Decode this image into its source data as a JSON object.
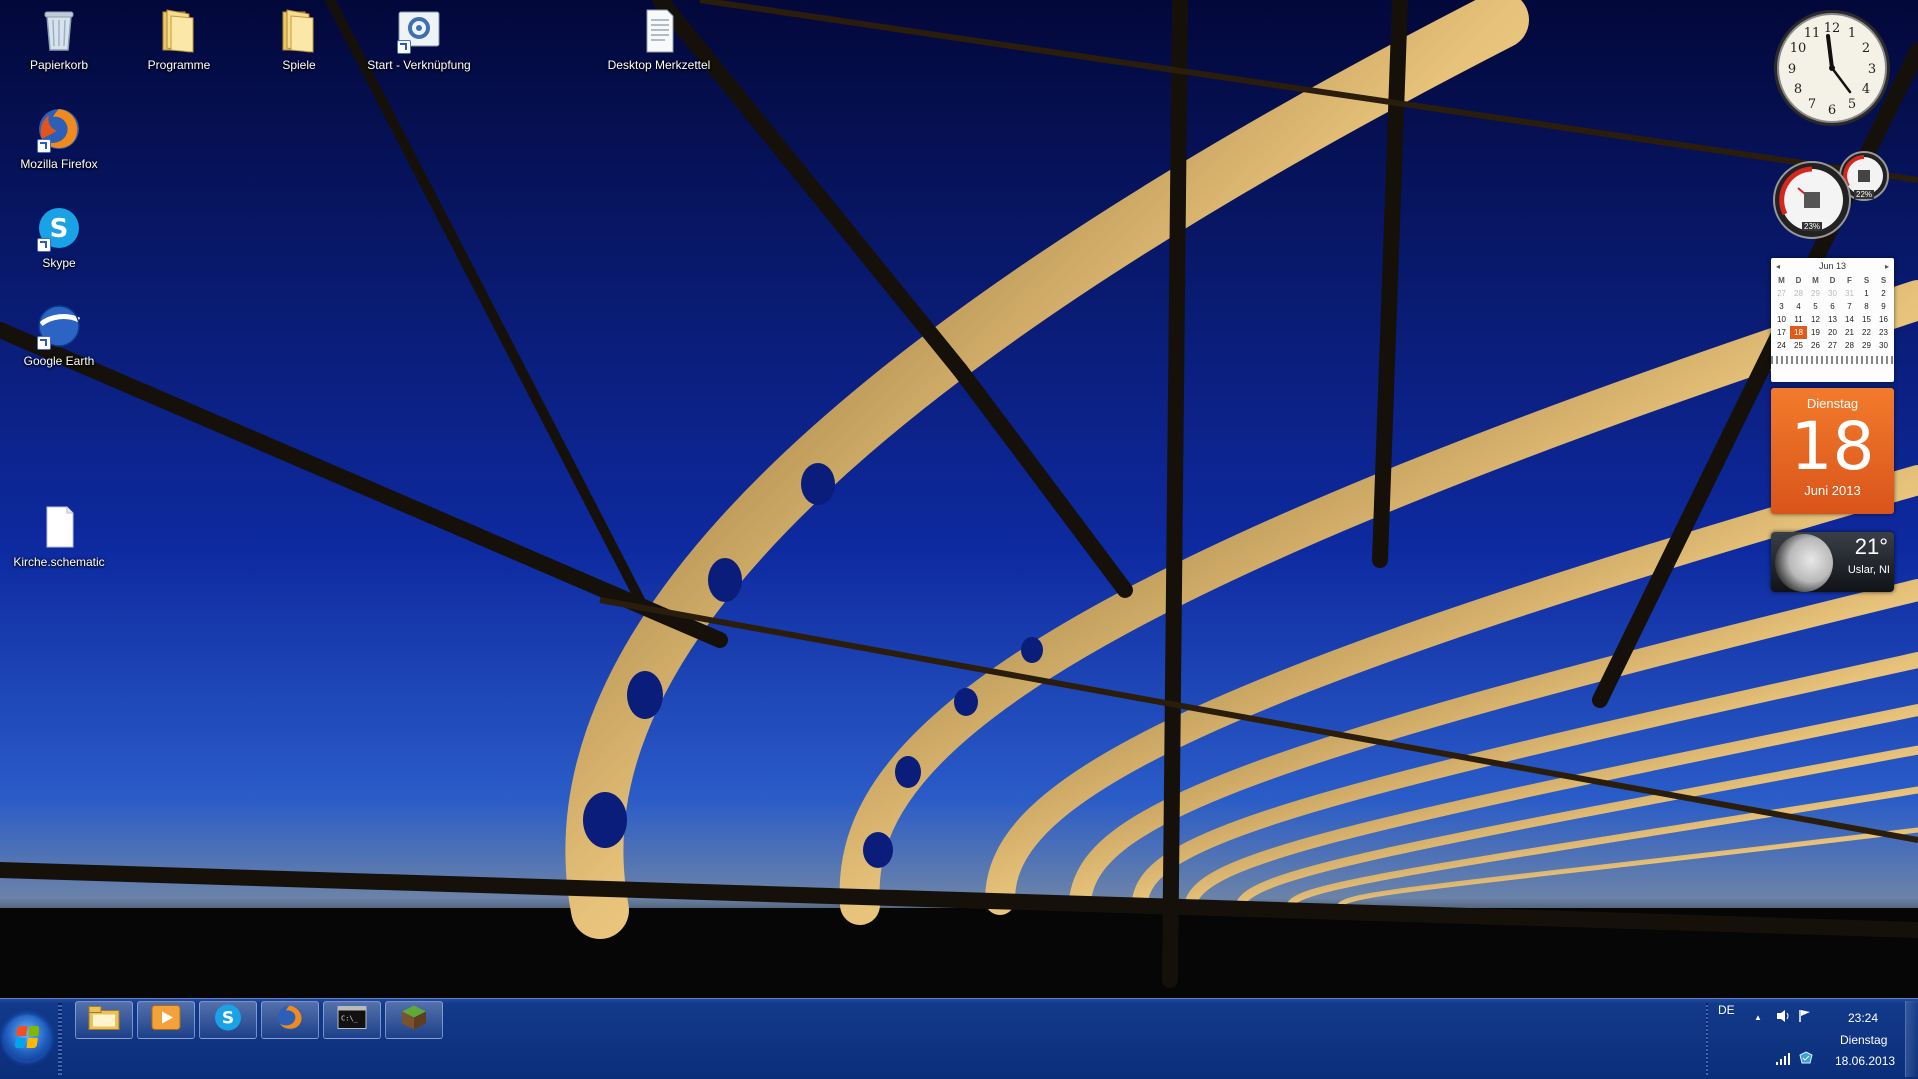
{
  "desktop": {
    "icons": [
      {
        "label": "Papierkorb",
        "icon": "recycle-bin-icon"
      },
      {
        "label": "Programme",
        "icon": "folder-icon"
      },
      {
        "label": "Spiele",
        "icon": "folder-icon"
      },
      {
        "label": "Start - Verknüpfung",
        "icon": "shortcut-settings-icon"
      },
      {
        "label": "Desktop Merkzettel",
        "icon": "text-document-icon"
      },
      {
        "label": "Mozilla Firefox",
        "icon": "firefox-icon"
      },
      {
        "label": "Skype",
        "icon": "skype-icon"
      },
      {
        "label": "Google Earth",
        "icon": "google-earth-icon"
      },
      {
        "label": "Kirche.schematic",
        "icon": "blank-file-icon"
      }
    ]
  },
  "gadgets": {
    "clock": {
      "numerals": [
        "12",
        "1",
        "2",
        "3",
        "4",
        "5",
        "6",
        "7",
        "8",
        "9",
        "10",
        "11"
      ]
    },
    "cpu_meter": {
      "cpu_percent": "23%",
      "ram_percent": "22%"
    },
    "calendar": {
      "month_title": "Jun 13",
      "prev": "◂",
      "next": "▸",
      "weekdays": [
        "M",
        "D",
        "M",
        "D",
        "F",
        "S",
        "S"
      ],
      "weeks": [
        [
          "27",
          "28",
          "29",
          "30",
          "31",
          "1",
          "2"
        ],
        [
          "3",
          "4",
          "5",
          "6",
          "7",
          "8",
          "9"
        ],
        [
          "10",
          "11",
          "12",
          "13",
          "14",
          "15",
          "16"
        ],
        [
          "17",
          "18",
          "19",
          "20",
          "21",
          "22",
          "23"
        ],
        [
          "24",
          "25",
          "26",
          "27",
          "28",
          "29",
          "30"
        ]
      ],
      "today": "18",
      "weekday_name": "Dienstag",
      "month_year": "Juni 2013"
    },
    "weather": {
      "temperature": "21°",
      "location": "Uslar, NI"
    }
  },
  "taskbar": {
    "buttons": [
      {
        "name": "explorer",
        "icon": "folder-explorer-icon"
      },
      {
        "name": "media-player",
        "icon": "media-player-icon"
      },
      {
        "name": "skype",
        "icon": "skype-icon"
      },
      {
        "name": "firefox",
        "icon": "firefox-icon"
      },
      {
        "name": "cmd",
        "icon": "command-prompt-icon"
      },
      {
        "name": "minecraft",
        "icon": "minecraft-icon"
      }
    ],
    "tray": {
      "language": "DE",
      "show_hidden": "▲",
      "time": "23:24",
      "day": "Dienstag",
      "date": "18.06.2013"
    }
  },
  "colors": {
    "taskbar": "#0b2e7a",
    "calendar_accent": "#e25a1a"
  }
}
